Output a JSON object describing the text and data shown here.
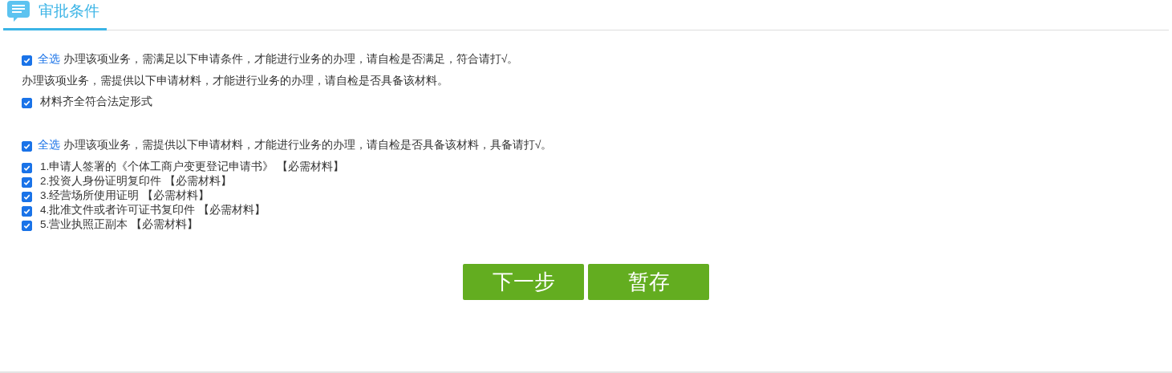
{
  "header": {
    "title": "审批条件"
  },
  "sections": [
    {
      "select_all": {
        "label": "全选",
        "text": "办理该项业务，需满足以下申请条件，才能进行业务的办理，请自检是否满足，符合请打√。",
        "checked": true
      },
      "note": "办理该项业务，需提供以下申请材料，才能进行业务的办理，请自检是否具备该材料。",
      "items": [
        {
          "label": "材料齐全符合法定形式",
          "checked": true
        }
      ]
    },
    {
      "select_all": {
        "label": "全选",
        "text": "办理该项业务，需提供以下申请材料，才能进行业务的办理，请自检是否具备该材料，具备请打√。",
        "checked": true
      },
      "items": [
        {
          "label": "1.申请人签署的《个体工商户变更登记申请书》 【必需材料】",
          "checked": true
        },
        {
          "label": "2.投资人身份证明复印件 【必需材料】",
          "checked": true
        },
        {
          "label": "3.经营场所使用证明 【必需材料】",
          "checked": true
        },
        {
          "label": "4.批准文件或者许可证书复印件 【必需材料】",
          "checked": true
        },
        {
          "label": "5.营业执照正副本 【必需材料】",
          "checked": true
        }
      ]
    }
  ],
  "buttons": [
    {
      "label": "下一步"
    },
    {
      "label": "暂存"
    }
  ]
}
